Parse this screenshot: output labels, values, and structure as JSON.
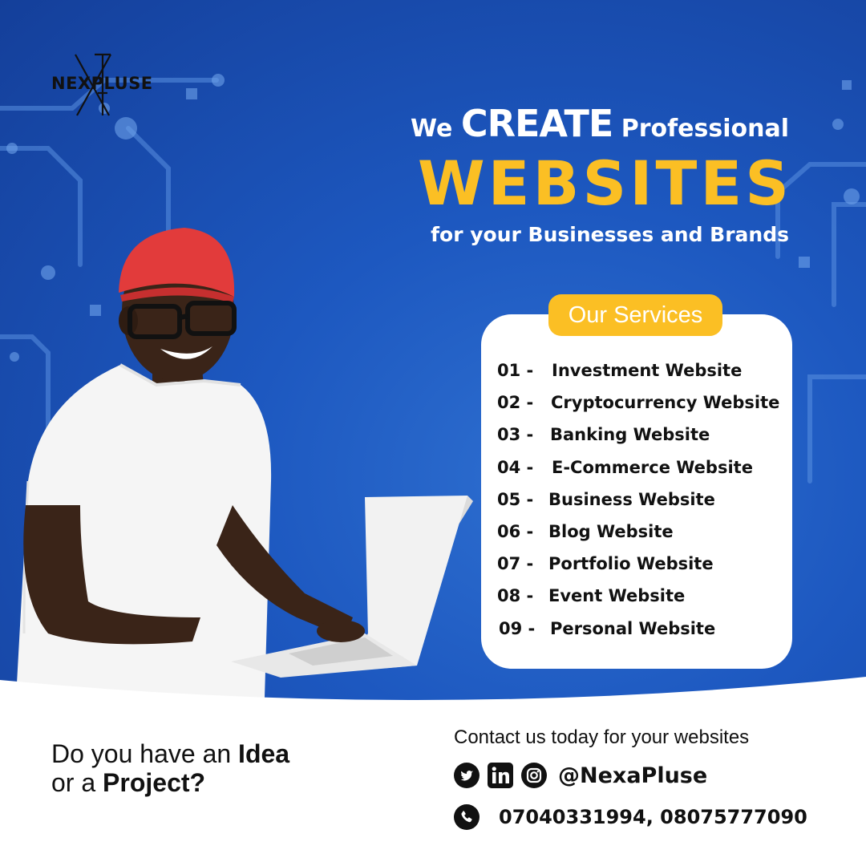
{
  "brand": {
    "logo_text": "NEXPLUSE"
  },
  "headline": {
    "line1_pre": "We",
    "line1_big": "CREATE",
    "line1_post": "Professional",
    "line2": "WEBSITES",
    "line3": "for your Businesses and Brands"
  },
  "services": {
    "title": "Our Services",
    "items": [
      {
        "num": "01 -",
        "label": "Investment Website"
      },
      {
        "num": "02 -",
        "label": "Cryptocurrency Website"
      },
      {
        "num": "03 -",
        "label": "Banking Website"
      },
      {
        "num": "04 -",
        "label": "E-Commerce Website"
      },
      {
        "num": "05 -",
        "label": "Business Website"
      },
      {
        "num": "06 -",
        "label": "Blog Website"
      },
      {
        "num": "07 -",
        "label": "Portfolio Website"
      },
      {
        "num": "08 -",
        "label": "Event Website"
      },
      {
        "num": "09 -",
        "label": "Personal Website"
      }
    ]
  },
  "footer": {
    "question_pre1": "Do you have an",
    "question_bold1": "Idea",
    "question_pre2": "or a",
    "question_bold2": "Project?",
    "contact_intro": "Contact us today for your websites",
    "social_icons": [
      "twitter-icon",
      "linkedin-icon",
      "instagram-icon"
    ],
    "handle": "@NexaPluse",
    "phone_icon": "phone-icon",
    "phones": "07040331994, 08075777090"
  },
  "colors": {
    "accent_yellow": "#fbbf24",
    "background_blue": "#1d58c0",
    "card_white": "#ffffff",
    "text_dark": "#111111"
  }
}
